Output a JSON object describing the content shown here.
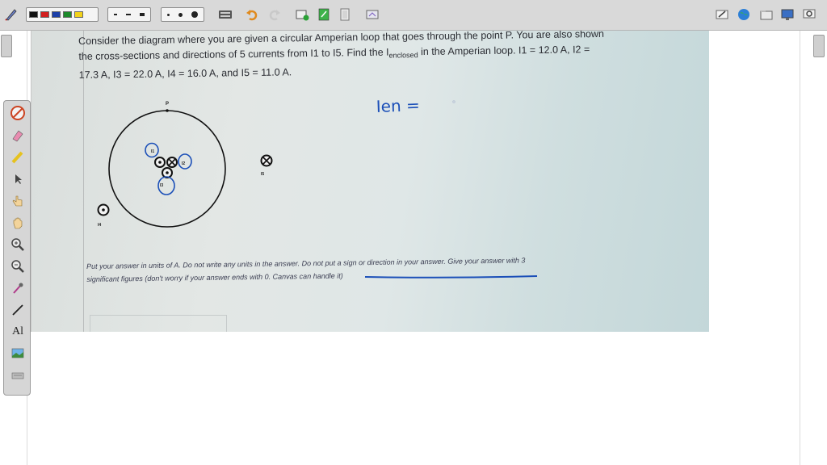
{
  "toolbar": {
    "icons": [
      "pen-icon",
      "color-swatches",
      "line-styles",
      "line-widths",
      "keyboard-icon",
      "undo-icon",
      "redo-icon",
      "add-page-icon",
      "document-icon",
      "page-icon",
      "screen-icon",
      "edit-icon",
      "globe-icon",
      "folder-icon",
      "display-icon",
      "settings-icon"
    ],
    "colors": [
      "#111111",
      "#d21f1f",
      "#1c3fa8",
      "#1d8a2b",
      "#f2d21a"
    ]
  },
  "palette": {
    "icons": [
      "no-pen-icon",
      "eraser-icon",
      "highlighter-icon",
      "pointer-icon",
      "hand-pointer-icon",
      "hand-icon",
      "zoom-in-icon",
      "zoom-out-icon",
      "pipette-icon",
      "line-icon",
      "text-icon",
      "image-icon",
      "stamp-icon"
    ],
    "text_tool_label": "Al"
  },
  "question": {
    "line1": "Consider the diagram where you are given a circular Amperian loop that goes through the point P.  You are also shown",
    "line2a": "the cross-sections and directions of 5 currents from I1 to I5.  Find the I",
    "line2_sub": "enclosed",
    "line2b": " in the Amperian loop.  I1 = 12.0 A, I2 =",
    "line3": "17.3 A, I3 = 22.0 A, I4 = 16.0 A, and I5 = 11.0 A."
  },
  "diagram": {
    "point_label": "P",
    "currents": [
      {
        "label": "I1",
        "direction": "out"
      },
      {
        "label": "I2",
        "direction": "in"
      },
      {
        "label": "I3",
        "direction": "out"
      },
      {
        "label": "I4",
        "direction": "out"
      },
      {
        "label": "I5",
        "direction": "in"
      }
    ]
  },
  "handwriting": {
    "answer": "Ien =",
    "ink_color": "#1b4fb8"
  },
  "instructions": {
    "part1": "Put your answer in units of A.  Do not write any units in the answer.  ",
    "underlined": "Do not put a sign or direction in your answer.",
    "part2": "  Give your answer with 3",
    "line2": "significant figures (don't worry if your answer ends with 0.  Canvas can handle it)"
  }
}
